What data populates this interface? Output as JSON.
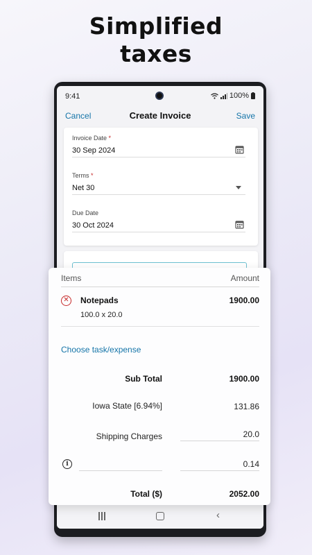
{
  "headline": {
    "line1": "Simplified",
    "line2": "taxes"
  },
  "status_bar": {
    "time": "9:41",
    "battery": "100%"
  },
  "app_bar": {
    "cancel": "Cancel",
    "title": "Create Invoice",
    "save": "Save"
  },
  "form": {
    "invoice_date": {
      "label": "Invoice Date",
      "required_mark": "*",
      "value": "30 Sep 2024",
      "icon": "calendar-icon"
    },
    "terms": {
      "label": "Terms",
      "required_mark": "*",
      "value": "Net 30",
      "icon": "dropdown-arrow-icon"
    },
    "due_date": {
      "label": "Due Date",
      "value": "30 Oct 2024",
      "icon": "calendar-icon"
    }
  },
  "items": {
    "header_items": "Items",
    "header_amount": "Amount",
    "rows": [
      {
        "name": "Notepads",
        "detail": "100.0 x 20.0",
        "amount": "1900.00"
      }
    ],
    "choose_link": "Choose task/expense"
  },
  "totals": {
    "sub_total_label": "Sub Total",
    "sub_total_value": "1900.00",
    "tax_label": "Iowa State [6.94%]",
    "tax_value": "131.86",
    "shipping_label": "Shipping Charges",
    "shipping_value": "20.0",
    "adjustment_value": "0.14",
    "total_label": "Total ($)",
    "total_value": "2052.00"
  },
  "colors": {
    "accent": "#1474a8",
    "required": "#c62828",
    "remove": "#c62828"
  }
}
